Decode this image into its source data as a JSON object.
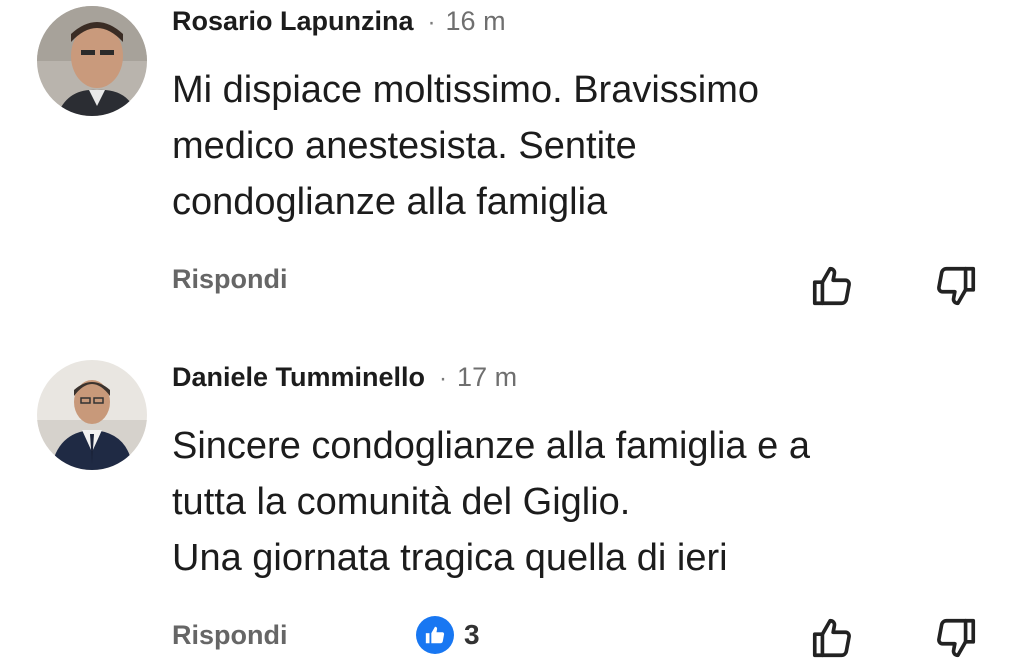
{
  "comments": [
    {
      "author": "Rosario Lapunzina",
      "separator": "·",
      "time": "16 m",
      "text_lines": [
        "Mi dispiace moltissimo. Bravissimo",
        "medico anestesista. Sentite",
        "condoglianze alla famiglia"
      ],
      "reply_label": "Rispondi",
      "avatar_icon": "avatar-photo",
      "upvote_icon": "thumbs-up-icon",
      "downvote_icon": "thumbs-down-icon"
    },
    {
      "author": "Daniele Tumminello",
      "separator": "·",
      "time": "17 m",
      "text_lines": [
        "Sincere condoglianze alla famiglia e a",
        "tutta la comunità del Giglio.",
        "Una giornata tragica quella di ieri"
      ],
      "reply_label": "Rispondi",
      "reaction_icon": "like-reaction-icon",
      "reaction_count": "3",
      "avatar_icon": "avatar-photo",
      "upvote_icon": "thumbs-up-icon",
      "downvote_icon": "thumbs-down-icon"
    }
  ],
  "colors": {
    "text": "#1c1c1c",
    "secondary": "#6f6f6f",
    "reply": "#666666",
    "like_blue": "#1877f2"
  }
}
